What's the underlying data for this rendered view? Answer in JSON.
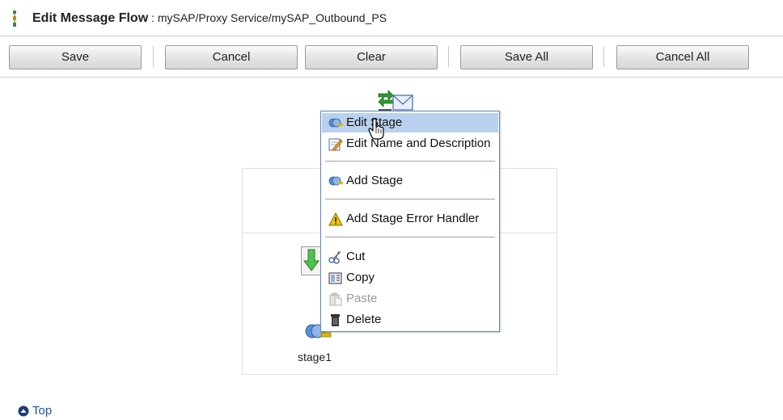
{
  "header": {
    "title": "Edit Message Flow",
    "separator": " : ",
    "path": "mySAP/Proxy Service/mySAP_Outbound_PS",
    "icon": "message-flow-icon"
  },
  "toolbar": {
    "save_label": "Save",
    "cancel_label": "Cancel",
    "clear_label": "Clear",
    "save_all_label": "Save All",
    "cancel_all_label": "Cancel All"
  },
  "canvas": {
    "stage_label": "stage1"
  },
  "context_menu": {
    "items": [
      {
        "label": "Edit Stage",
        "icon": "stage-icon",
        "highlighted": true
      },
      {
        "label": "Edit Name and Description",
        "icon": "edit-pencil-icon"
      },
      {
        "label": "Add Stage",
        "icon": "stage-icon"
      },
      {
        "label": "Add Stage Error Handler",
        "icon": "warning-icon"
      },
      {
        "label": "Cut",
        "icon": "scissors-icon"
      },
      {
        "label": "Copy",
        "icon": "copy-icon"
      },
      {
        "label": "Paste",
        "icon": "paste-icon",
        "disabled": true
      },
      {
        "label": "Delete",
        "icon": "trash-icon"
      }
    ]
  },
  "footer": {
    "top_link": "Top"
  },
  "colors": {
    "menu_highlight": "#b9d1ef",
    "menu_border": "#5d84c0",
    "link": "#1a53a8"
  }
}
